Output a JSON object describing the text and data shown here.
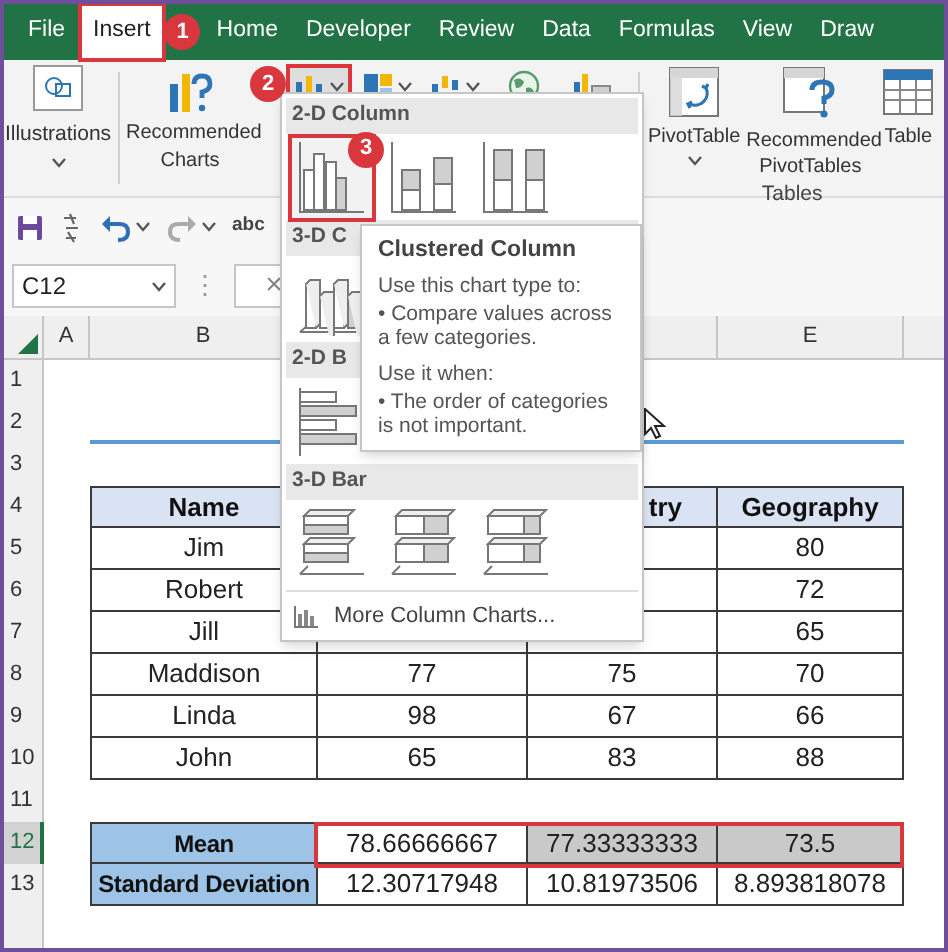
{
  "tabs": [
    {
      "label": "File",
      "selected": false
    },
    {
      "label": "Insert",
      "selected": true,
      "badge": "1"
    },
    {
      "label": "Home",
      "selected": false
    },
    {
      "label": "Developer",
      "selected": false
    },
    {
      "label": "Review",
      "selected": false
    },
    {
      "label": "Data",
      "selected": false
    },
    {
      "label": "Formulas",
      "selected": false
    },
    {
      "label": "View",
      "selected": false
    },
    {
      "label": "Draw",
      "selected": false
    }
  ],
  "ribbon": {
    "illustrations": {
      "label": "Illustrations"
    },
    "recommended_charts": {
      "label": "Recommended Charts"
    },
    "chart_buttons": [
      {
        "kind": "column",
        "selected": true,
        "dropdown": true,
        "badge": "2"
      },
      {
        "kind": "hierarchy",
        "selected": false,
        "dropdown": true
      },
      {
        "kind": "waterfall",
        "selected": false,
        "dropdown": true
      },
      {
        "kind": "map",
        "selected": false,
        "dropdown": false
      },
      {
        "kind": "pivot-chart",
        "selected": false,
        "dropdown": false
      }
    ],
    "tables": {
      "label": "Tables",
      "buttons": [
        {
          "kind": "pivot-table",
          "label": "PivotTable",
          "dropdown": true
        },
        {
          "kind": "recommended-pivot",
          "label": "Recommended PivotTables",
          "dropdown": false
        },
        {
          "kind": "table",
          "label": "Table",
          "dropdown": false
        }
      ]
    }
  },
  "quick_access": [
    {
      "kind": "save"
    },
    {
      "kind": "formula"
    },
    {
      "kind": "undo",
      "dropdown": true
    },
    {
      "kind": "redo",
      "dropdown": true
    },
    {
      "kind": "spelling",
      "label": "abc"
    }
  ],
  "formula_bar": {
    "name_box": "C12",
    "more": "⋮",
    "cancel": "×"
  },
  "sheet": {
    "column_headers": {
      "A": "A",
      "B": "B",
      "E": "E"
    },
    "row_headers": [
      {
        "label": "1",
        "selected": false
      },
      {
        "label": "2",
        "selected": false
      },
      {
        "label": "3",
        "selected": false
      },
      {
        "label": "4",
        "selected": false
      },
      {
        "label": "5",
        "selected": false
      },
      {
        "label": "6",
        "selected": false
      },
      {
        "label": "7",
        "selected": false
      },
      {
        "label": "8",
        "selected": false
      },
      {
        "label": "9",
        "selected": false
      },
      {
        "label": "10",
        "selected": false
      },
      {
        "label": "11",
        "selected": false
      },
      {
        "label": "12",
        "selected": true
      },
      {
        "label": "13",
        "selected": false
      }
    ],
    "table": {
      "header": {
        "B": "Name",
        "D": "try",
        "E": "Geography"
      },
      "rows": [
        {
          "B": "Jim",
          "E": "80"
        },
        {
          "B": "Robert",
          "E": "72"
        },
        {
          "B": "Jill",
          "E": "65"
        },
        {
          "B": "Maddison",
          "C": "77",
          "D": "75",
          "E": "70"
        },
        {
          "B": "Linda",
          "C": "98",
          "D": "67",
          "E": "66"
        },
        {
          "B": "John",
          "C": "65",
          "D": "83",
          "E": "88"
        }
      ],
      "summary": [
        {
          "label": "Mean",
          "values": [
            {
              "text": "78.66666667",
              "shaded": false
            },
            {
              "text": "77.33333333",
              "shaded": true
            },
            {
              "text": "73.5",
              "shaded": true
            }
          ]
        },
        {
          "label": "Standard Deviation",
          "values": [
            {
              "text": "12.30717948",
              "shaded": false
            },
            {
              "text": "10.81973506",
              "shaded": false
            },
            {
              "text": "8.893818078",
              "shaded": false
            }
          ]
        }
      ]
    }
  },
  "chart_menu": {
    "sections": [
      {
        "title": "2-D Column",
        "kind": "column-2d",
        "icons": [
          {
            "kind": "clustered",
            "selected": true,
            "badge": "3"
          },
          {
            "kind": "stacked",
            "selected": false
          },
          {
            "kind": "stacked-100",
            "selected": false
          }
        ]
      },
      {
        "title": "3-D C",
        "kind": "column-3d",
        "icons": [
          {
            "kind": "clustered",
            "selected": false
          }
        ]
      },
      {
        "title": "2-D B",
        "kind": "bar-2d",
        "icons": [
          {
            "kind": "clustered",
            "selected": false
          }
        ]
      },
      {
        "title": "3-D Bar",
        "kind": "bar-3d",
        "icons": [
          {
            "kind": "clustered",
            "selected": false
          },
          {
            "kind": "stacked",
            "selected": false
          },
          {
            "kind": "stacked-100",
            "selected": false
          }
        ]
      }
    ],
    "more": "More Column Charts..."
  },
  "tooltip": {
    "title": "Clustered Column",
    "groups": [
      {
        "heading": "Use this chart type to:",
        "bullet": "• Compare values across a few categories."
      },
      {
        "heading": "Use it when:",
        "bullet": "• The order of categories is not important."
      }
    ]
  }
}
